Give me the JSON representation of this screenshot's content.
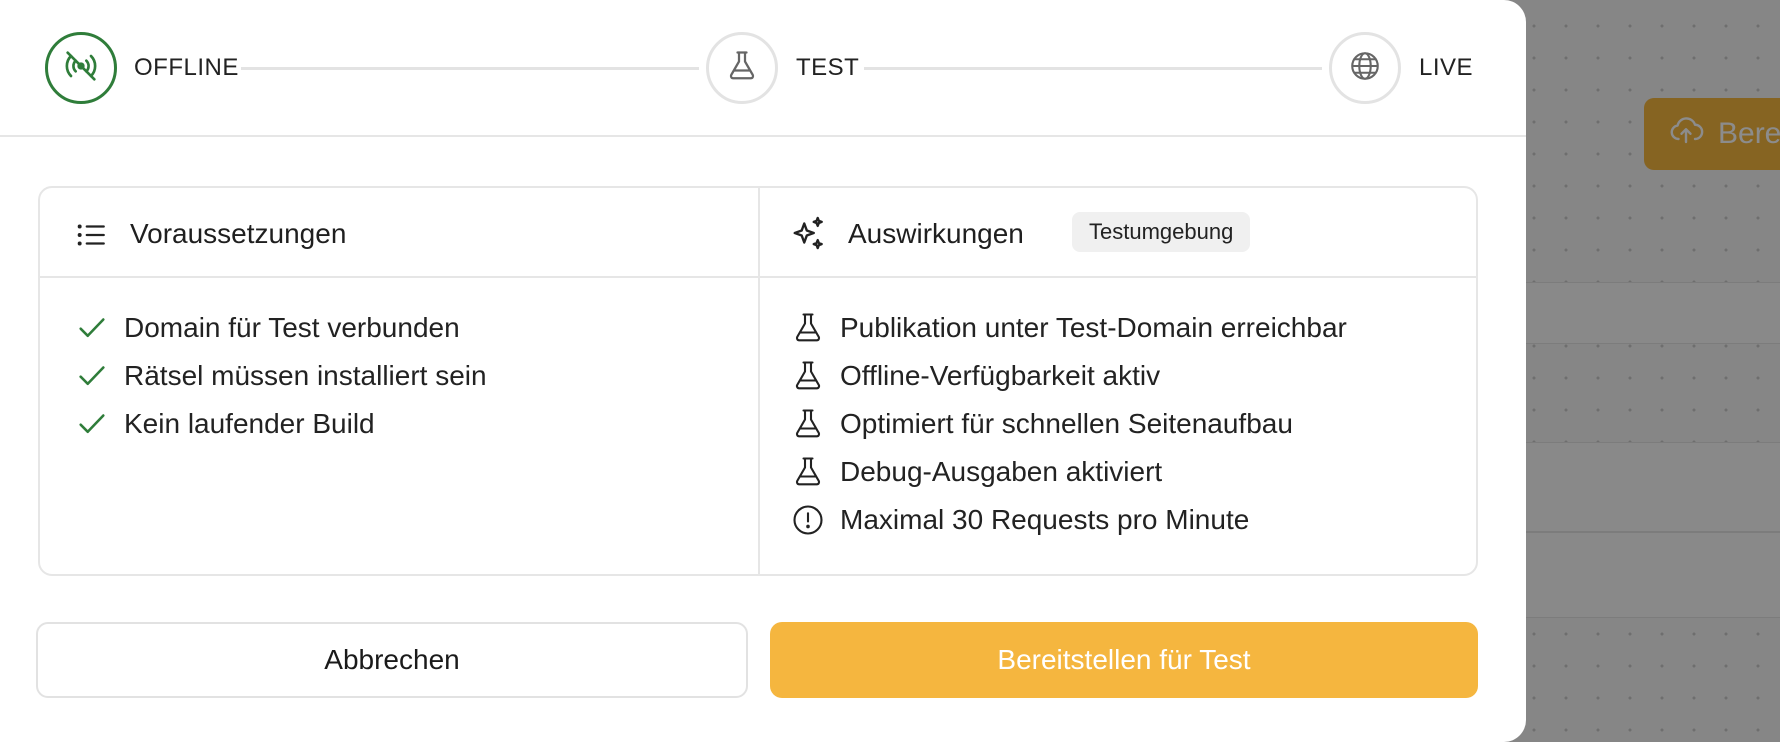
{
  "colors": {
    "accent": "#f5b63f",
    "success": "#2f7d3a",
    "border": "#e6e6e6"
  },
  "stepper": {
    "steps": [
      {
        "label": "OFFLINE",
        "icon": "broadcast-off-icon",
        "active": true
      },
      {
        "label": "TEST",
        "icon": "flask-icon",
        "active": false
      },
      {
        "label": "LIVE",
        "icon": "globe-icon",
        "active": false
      }
    ]
  },
  "requirements": {
    "title": "Voraussetzungen",
    "icon": "list-icon",
    "items": [
      {
        "label": "Domain für Test verbunden",
        "icon": "check-icon"
      },
      {
        "label": "Rätsel müssen installiert sein",
        "icon": "check-icon"
      },
      {
        "label": "Kein laufender Build",
        "icon": "check-icon"
      }
    ]
  },
  "effects": {
    "title": "Auswirkungen",
    "icon": "sparkles-icon",
    "badge": "Testumgebung",
    "items": [
      {
        "label": "Publikation unter Test-Domain erreichbar",
        "icon": "flask-icon"
      },
      {
        "label": "Offline-Verfügbarkeit aktiv",
        "icon": "flask-icon"
      },
      {
        "label": "Optimiert für schnellen Seitenaufbau",
        "icon": "flask-icon"
      },
      {
        "label": "Debug-Ausgaben aktiviert",
        "icon": "flask-icon"
      },
      {
        "label": "Maximal 30 Requests pro Minute",
        "icon": "alert-circle-icon"
      }
    ]
  },
  "actions": {
    "cancel_label": "Abbrechen",
    "deploy_label": "Bereitstellen für Test"
  },
  "background": {
    "deploy_button_label": "Bere",
    "deploy_button_icon": "cloud-upload-icon"
  }
}
